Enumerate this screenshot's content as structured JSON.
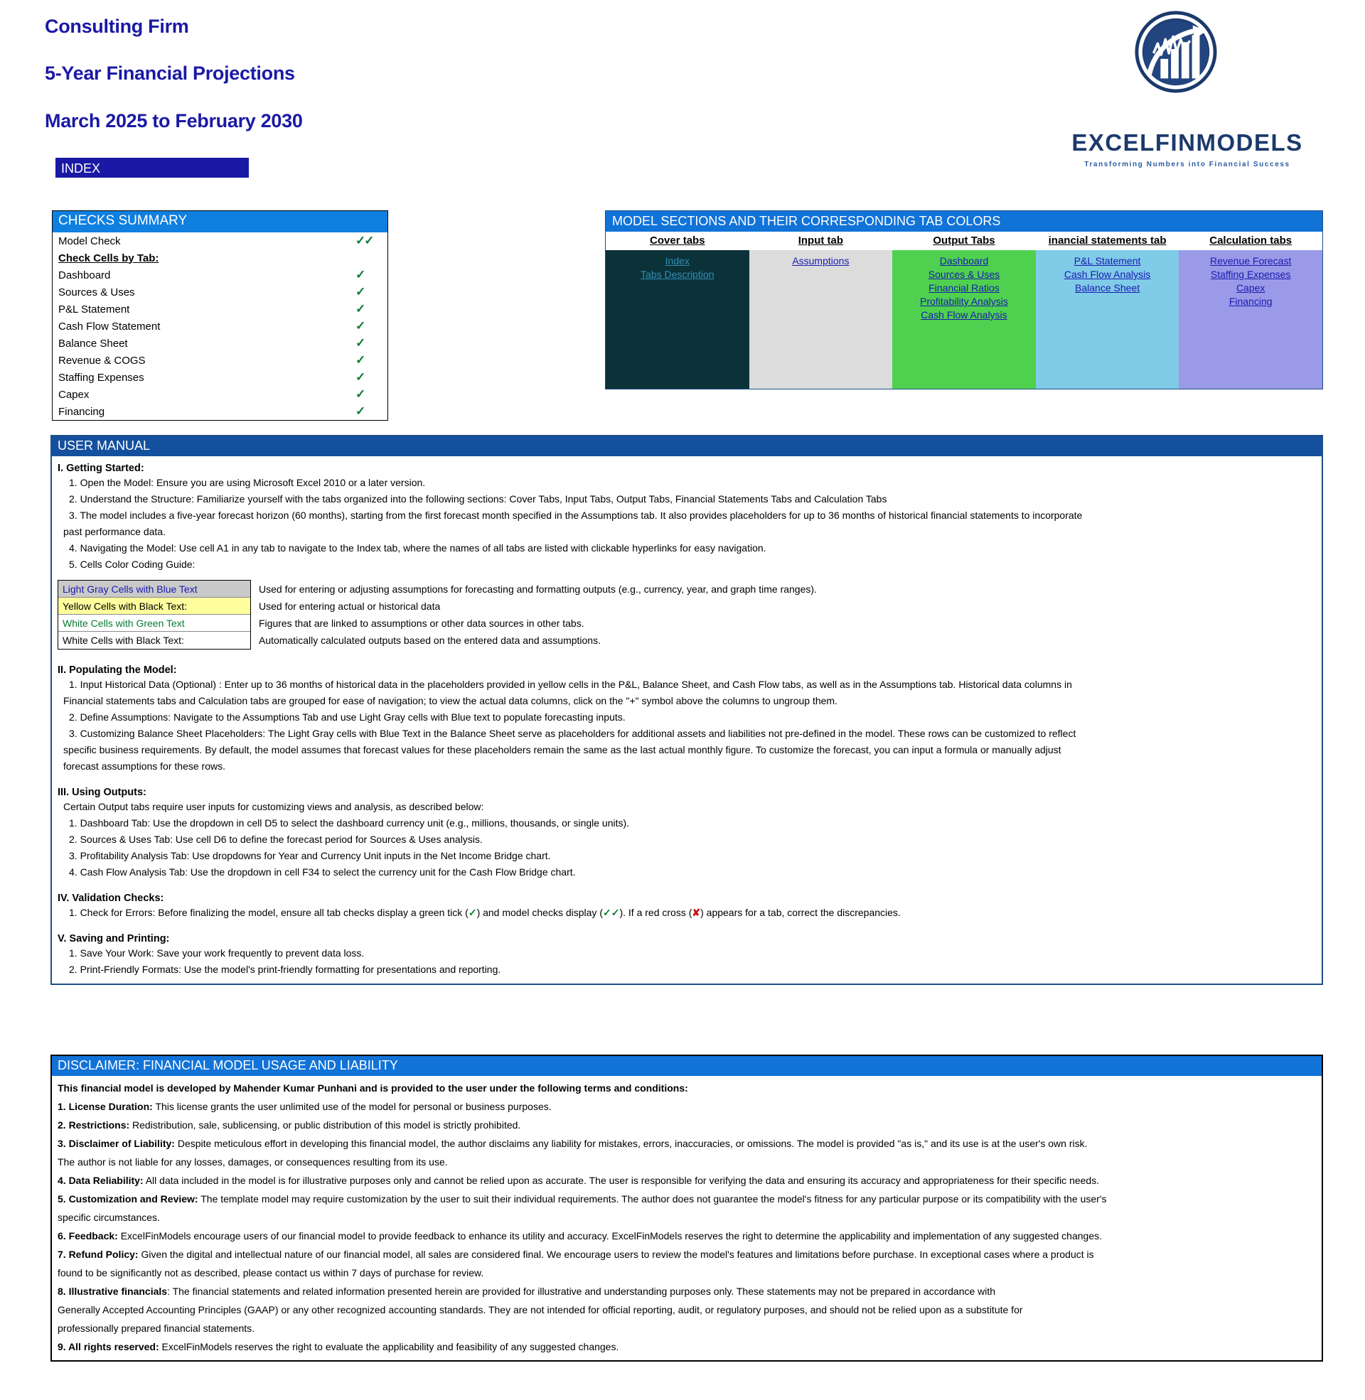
{
  "header": {
    "line1": "Consulting Firm",
    "line2": "5-Year Financial Projections",
    "line3": "March 2025 to February 2030",
    "index_badge": "INDEX"
  },
  "logo": {
    "name": "EXCELFINMODELS",
    "tagline": "Transforming Numbers into Financial Success",
    "icon": "bar-chart-arrow-circle-icon"
  },
  "checks": {
    "title": "CHECKS  SUMMARY",
    "model_check_label": "Model Check",
    "model_check_mark": "✓✓",
    "by_tab_label": "Check Cells by Tab:",
    "rows": [
      {
        "label": "Dashboard",
        "mark": "✓"
      },
      {
        "label": "Sources & Uses",
        "mark": "✓"
      },
      {
        "label": "P&L Statement",
        "mark": "✓"
      },
      {
        "label": "Cash Flow Statement",
        "mark": "✓"
      },
      {
        "label": "Balance Sheet",
        "mark": "✓"
      },
      {
        "label": "Revenue & COGS",
        "mark": "✓"
      },
      {
        "label": "Staffing Expenses",
        "mark": "✓"
      },
      {
        "label": "Capex",
        "mark": "✓"
      },
      {
        "label": "Financing",
        "mark": "✓"
      }
    ]
  },
  "sections": {
    "title": "MODEL SECTIONS AND THEIR CORRESPONDING TAB COLORS",
    "columns": [
      {
        "title": "Cover tabs",
        "color": "#0b3239",
        "links": [
          "Index",
          "Tabs Description"
        ]
      },
      {
        "title": "Input tab",
        "color": "#dcdcdc",
        "links": [
          "Assumptions "
        ]
      },
      {
        "title": "Output Tabs",
        "color": "#4fd14f",
        "links": [
          "Dashboard",
          "Sources & Uses",
          "Financial Ratios ",
          "Profitability Analysis",
          "Cash Flow Analysis"
        ]
      },
      {
        "title": "inancial statements tab",
        "color": "#7fcbe8",
        "links": [
          "P&L Statement",
          "Cash Flow Analysis",
          "Balance Sheet"
        ]
      },
      {
        "title": "Calculation tabs",
        "color": "#9a9ae8",
        "links": [
          "Revenue Forecast",
          "Staffing Expenses",
          "Capex ",
          "Financing"
        ]
      }
    ]
  },
  "manual": {
    "title": "USER MANUAL",
    "s1_heading": "I. Getting Started:",
    "s1_items": [
      "1. Open the Model: Ensure you are using Microsoft Excel 2010 or a later version.",
      "2. Understand the Structure: Familiarize yourself with the tabs organized into the following sections: Cover Tabs, Input Tabs, Output Tabs, Financial Statements Tabs and Calculation Tabs",
      "3. The model includes a five-year forecast horizon (60 months), starting from the first forecast month specified in the Assumptions tab. It also provides placeholders for up to 36 months of historical financial statements to incorporate",
      "past performance data.",
      "4. Navigating the Model: Use cell A1 in any tab to navigate to the Index tab, where the names of all tabs are listed with clickable hyperlinks for easy navigation.",
      "5. Cells Color Coding Guide:"
    ],
    "color_guide": [
      {
        "label": "Light Gray Cells with Blue Text",
        "desc": "Used for entering or adjusting assumptions for forecasting and formatting outputs (e.g., currency, year, and graph time ranges)."
      },
      {
        "label": "Yellow Cells with Black Text:",
        "desc": "Used for entering actual or historical data"
      },
      {
        "label": "White Cells with Green Text",
        "desc": "Figures that are linked to assumptions or other data sources in other tabs."
      },
      {
        "label": "White Cells with Black Text:",
        "desc": "Automatically calculated outputs based on the entered data and assumptions."
      }
    ],
    "s2_heading": "II. Populating the Model:",
    "s2_items": [
      "1. Input Historical Data (Optional) : Enter up to 36 months of historical data in the placeholders provided in yellow cells in the P&L, Balance Sheet, and Cash Flow tabs, as well as in the Assumptions tab. Historical data columns in",
      "Financial statements tabs and Calculation tabs are grouped for ease of navigation; to view the actual data columns, click on the \"+\" symbol above the columns to ungroup them.",
      "2. Define Assumptions: Navigate to the Assumptions Tab and use Light Gray cells with Blue text to populate forecasting inputs.",
      "3. Customizing Balance Sheet Placeholders: The Light Gray cells with Blue Text in the Balance Sheet serve as placeholders for additional assets and liabilities not pre-defined in the model. These rows can be customized to reflect",
      "specific business requirements. By default, the model assumes that forecast values for these placeholders remain the same as the last actual monthly figure. To customize the forecast, you can input a formula or manually adjust",
      "forecast assumptions for these rows."
    ],
    "s3_heading": "III. Using Outputs:",
    "s3_intro": "Certain Output tabs require user inputs for customizing views and analysis, as described below:",
    "s3_items": [
      "1. Dashboard Tab: Use the dropdown in cell D5 to select the dashboard currency unit (e.g., millions, thousands, or single units).",
      "2. Sources & Uses Tab: Use cell D6 to define the forecast period for Sources & Uses analysis.",
      "3. Profitability Analysis Tab: Use dropdowns for Year and Currency Unit inputs in the Net Income Bridge chart.",
      "4. Cash Flow Analysis Tab: Use the dropdown in cell F34 to select the currency unit for the Cash Flow Bridge chart."
    ],
    "s4_heading": "IV. Validation Checks:",
    "s4_item_a": "1. Check for Errors:  Before finalizing the model, ensure all tab checks display a green tick (",
    "s4_tick": "✓",
    "s4_item_b": ") and model checks display  (",
    "s4_dtick": "✓✓",
    "s4_item_c": "). If a red cross (",
    "s4_cross": "✘",
    "s4_item_d": ") appears for a tab, correct the discrepancies.",
    "s5_heading": "V. Saving and Printing:",
    "s5_items": [
      "1. Save Your Work: Save your work frequently to prevent data loss.",
      "2. Print-Friendly Formats: Use the model's print-friendly formatting for presentations and reporting."
    ]
  },
  "disclaimer": {
    "title": "DISCLAIMER: FINANCIAL MODEL USAGE AND LIABILITY",
    "lead": "This financial model  is developed by Mahender Kumar Punhani and is provided to the user under the following terms and conditions:",
    "items": [
      "1. License Duration: This license grants the user unlimited use of the model for personal or business purposes.",
      "2. Restrictions: Redistribution, sale, sublicensing, or public distribution of this model is strictly prohibited.",
      "3. Disclaimer of Liability: Despite meticulous effort in developing this financial model, the author disclaims any liability for mistakes, errors, inaccuracies, or omissions. The model is provided \"as is,\" and its use is at the user's own risk.",
      "The author is not liable for  any losses, damages, or consequences resulting from its use.",
      "4. Data Reliability: All data included in the model is for illustrative purposes only and cannot be relied upon as accurate. The user is  responsible for verifying the data and ensuring its accuracy and appropriateness for their specific needs.",
      "5. Customization and Review: The template model may require customization by the user to suit their individual requirements. The author does not guarantee the model's fitness for any  particular purpose or its compatibility with the user's",
      "specific circumstances.",
      "6. Feedback: ExcelFinModels encourage users of our financial model to provide feedback to enhance its utility and accuracy. ExcelFinModels reserves the right to determine the applicability and implementation of any suggested changes.",
      "7. Refund Policy: Given the digital and intellectual nature of our financial model, all sales are considered final. We encourage users to review the model's features and limitations before purchase. In exceptional cases where a product is",
      "found to be  significantly not as described, please contact us within 7 days of purchase for review.",
      "8. Illustrative financials: The financial statements and related information presented herein are provided for illustrative and understanding purposes only. These statements may not be prepared in accordance with",
      "Generally Accepted Accounting Principles (GAAP)  or any other  recognized accounting standards. They are not intended for official reporting, audit, or regulatory purposes, and should not be relied upon as a substitute for",
      "professionally prepared financial statements.",
      "9. All rights reserved: ExcelFinModels reserves the right to evaluate the applicability and feasibility of any suggested changes."
    ],
    "bold_leads": [
      "1. License Duration:",
      "2. Restrictions:",
      "3. Disclaimer of Liability:",
      "4. Data Reliability:",
      "5. Customization and Review:",
      "6. Feedback:",
      "7. Refund Policy:",
      "8. Illustrative financials",
      "9. All rights reserved:"
    ]
  }
}
